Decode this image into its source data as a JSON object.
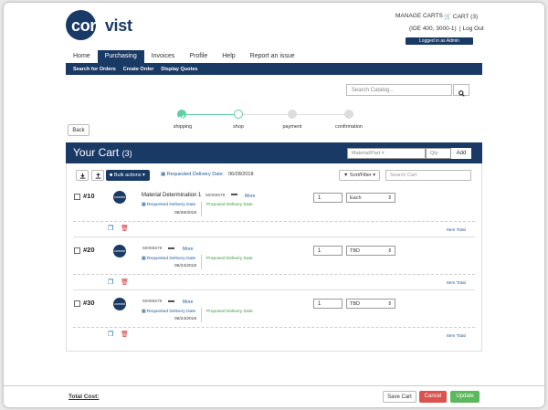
{
  "brand": {
    "logo_a": "core",
    "logo_b": "vist"
  },
  "top": {
    "manage_carts": "MANAGE CARTS",
    "cart": "CART (3)",
    "user": "(IDE 400, 3000-1)",
    "logout": "Log Out",
    "admin_badge": "Logged in as Admin"
  },
  "nav": {
    "items": [
      {
        "label": "Home"
      },
      {
        "label": "Purchasing"
      },
      {
        "label": "Invoices"
      },
      {
        "label": "Profile"
      },
      {
        "label": "Help"
      },
      {
        "label": "Report an issue"
      }
    ]
  },
  "subnav": {
    "items": [
      {
        "label": "Search for Orders"
      },
      {
        "label": "Create Order"
      },
      {
        "label": "Display Quotes"
      }
    ]
  },
  "search": {
    "placeholder": "Search Catalog..."
  },
  "back_label": "Back",
  "steps": [
    {
      "label": "shipping",
      "state": "done"
    },
    {
      "label": "shop",
      "state": "current"
    },
    {
      "label": "payment",
      "state": "todo"
    },
    {
      "label": "confirmation",
      "state": "todo"
    }
  ],
  "cart": {
    "title": "Your Cart",
    "count": "(3)",
    "material_placeholder": "Material/Part #",
    "qty_placeholder": "Qty",
    "add_label": "Add"
  },
  "toolbar": {
    "bulk_label": "Bulk actions ▾",
    "req_label": "Requested Delivery Date",
    "req_date": "06/28/2018",
    "sort_label": "Sort/Filter ▾",
    "search_placeholder": "Search Cart"
  },
  "items": [
    {
      "no": "#10",
      "desc": "Material Determination 1",
      "pn": "50065579",
      "more": "More",
      "req_label": "Requested Delivery Date",
      "req_date": "06/28/2018",
      "prop_label": "Proposed Delivery Date",
      "qty": "1",
      "uom": "Each",
      "total_label": "Item Total"
    },
    {
      "no": "#20",
      "desc": "",
      "pn": "50065579",
      "more": "More",
      "req_label": "Requested Delivery Date",
      "req_date": "06/24/2018",
      "prop_label": "Proposed Delivery Date",
      "qty": "1",
      "uom": "TBD",
      "total_label": "Item Total"
    },
    {
      "no": "#30",
      "desc": "",
      "pn": "50065579",
      "more": "More",
      "req_label": "Requested Delivery Date",
      "req_date": "06/24/2018",
      "prop_label": "Proposed Delivery Date",
      "qty": "1",
      "uom": "TBD",
      "total_label": "Item Total"
    }
  ],
  "footer": {
    "total_cost_label": "Total Cost:",
    "save_label": "Save Cart",
    "cancel_label": "Cancel",
    "update_label": "Update"
  },
  "colors": {
    "brand_navy": "#1a3a66",
    "step_green": "#5fd0a0",
    "cancel_red": "#d9534f",
    "update_green": "#5cb85c"
  }
}
